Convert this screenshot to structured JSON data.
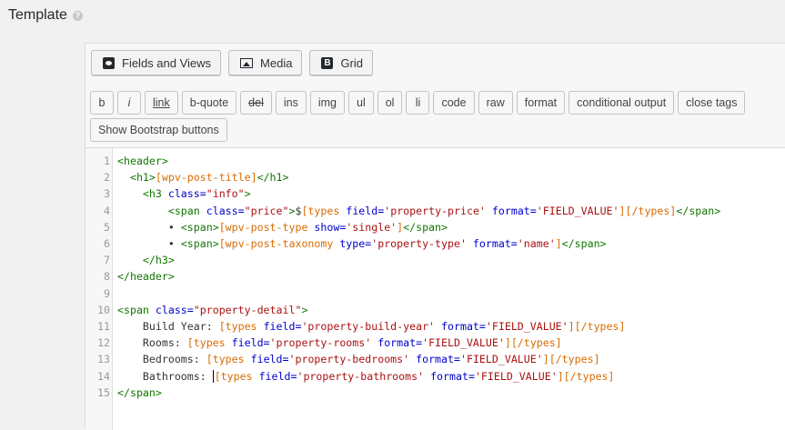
{
  "page": {
    "title": "Template",
    "help_icon": "?"
  },
  "toolbar": {
    "fields_views": "Fields and Views",
    "media": "Media",
    "grid": "Grid",
    "grid_icon_letter": "B"
  },
  "quicktags": {
    "row1": [
      "b",
      "i",
      "link",
      "b-quote",
      "del",
      "ins",
      "img",
      "ul",
      "ol",
      "li",
      "code",
      "raw",
      "format",
      "conditional output",
      "close tags"
    ],
    "row2": [
      "Show Bootstrap buttons"
    ]
  },
  "code": {
    "line_numbers": [
      "1",
      "2",
      "3",
      "4",
      "5",
      "6",
      "7",
      "8",
      "9",
      "10",
      "11",
      "12",
      "13",
      "14",
      "15"
    ],
    "lines": [
      [
        [
          "t",
          "<header>"
        ]
      ],
      [
        [
          "p",
          "  "
        ],
        [
          "t",
          "<h1>"
        ],
        [
          "s",
          "[wpv-post-title]"
        ],
        [
          "t",
          "</h1>"
        ]
      ],
      [
        [
          "p",
          "    "
        ],
        [
          "t",
          "<h3 "
        ],
        [
          "a",
          "class="
        ],
        [
          "r",
          "\"info\""
        ],
        [
          "t",
          ">"
        ]
      ],
      [
        [
          "p",
          "        "
        ],
        [
          "t",
          "<span "
        ],
        [
          "a",
          "class="
        ],
        [
          "r",
          "\"price\""
        ],
        [
          "t",
          ">"
        ],
        [
          "p",
          "$"
        ],
        [
          "s",
          "[types "
        ],
        [
          "a",
          "field="
        ],
        [
          "r",
          "'property-price'"
        ],
        [
          "p",
          " "
        ],
        [
          "a",
          "format="
        ],
        [
          "r",
          "'FIELD_VALUE'"
        ],
        [
          "s",
          "][/types]"
        ],
        [
          "t",
          "</span>"
        ]
      ],
      [
        [
          "p",
          "        • "
        ],
        [
          "t",
          "<span>"
        ],
        [
          "s",
          "[wpv-post-type "
        ],
        [
          "a",
          "show="
        ],
        [
          "r",
          "'single'"
        ],
        [
          "s",
          "]"
        ],
        [
          "t",
          "</span>"
        ]
      ],
      [
        [
          "p",
          "        • "
        ],
        [
          "t",
          "<span>"
        ],
        [
          "s",
          "[wpv-post-taxonomy "
        ],
        [
          "a",
          "type="
        ],
        [
          "r",
          "'property-type'"
        ],
        [
          "p",
          " "
        ],
        [
          "a",
          "format="
        ],
        [
          "r",
          "'name'"
        ],
        [
          "s",
          "]"
        ],
        [
          "t",
          "</span>"
        ]
      ],
      [
        [
          "p",
          "    "
        ],
        [
          "t",
          "</h3>"
        ]
      ],
      [
        [
          "t",
          "</header>"
        ]
      ],
      [
        [
          "p",
          ""
        ]
      ],
      [
        [
          "t",
          "<span "
        ],
        [
          "a",
          "class="
        ],
        [
          "r",
          "\"property-detail\""
        ],
        [
          "t",
          ">"
        ]
      ],
      [
        [
          "p",
          "    Build Year: "
        ],
        [
          "s",
          "[types "
        ],
        [
          "a",
          "field="
        ],
        [
          "r",
          "'property-build-year'"
        ],
        [
          "p",
          " "
        ],
        [
          "a",
          "format="
        ],
        [
          "r",
          "'FIELD_VALUE'"
        ],
        [
          "s",
          "][/types]"
        ]
      ],
      [
        [
          "p",
          "    Rooms: "
        ],
        [
          "s",
          "[types "
        ],
        [
          "a",
          "field="
        ],
        [
          "r",
          "'property-rooms'"
        ],
        [
          "p",
          " "
        ],
        [
          "a",
          "format="
        ],
        [
          "r",
          "'FIELD_VALUE'"
        ],
        [
          "s",
          "][/types]"
        ]
      ],
      [
        [
          "p",
          "    Bedrooms: "
        ],
        [
          "s",
          "[types "
        ],
        [
          "a",
          "field="
        ],
        [
          "r",
          "'property-bedrooms'"
        ],
        [
          "p",
          " "
        ],
        [
          "a",
          "format="
        ],
        [
          "r",
          "'FIELD_VALUE'"
        ],
        [
          "s",
          "][/types]"
        ]
      ],
      [
        [
          "p",
          "    Bathrooms: "
        ],
        [
          "c",
          ""
        ],
        [
          "s",
          "[types "
        ],
        [
          "a",
          "field="
        ],
        [
          "r",
          "'property-bathrooms'"
        ],
        [
          "p",
          " "
        ],
        [
          "a",
          "format="
        ],
        [
          "r",
          "'FIELD_VALUE'"
        ],
        [
          "s",
          "][/types]"
        ]
      ],
      [
        [
          "t",
          "</span>"
        ]
      ]
    ]
  }
}
